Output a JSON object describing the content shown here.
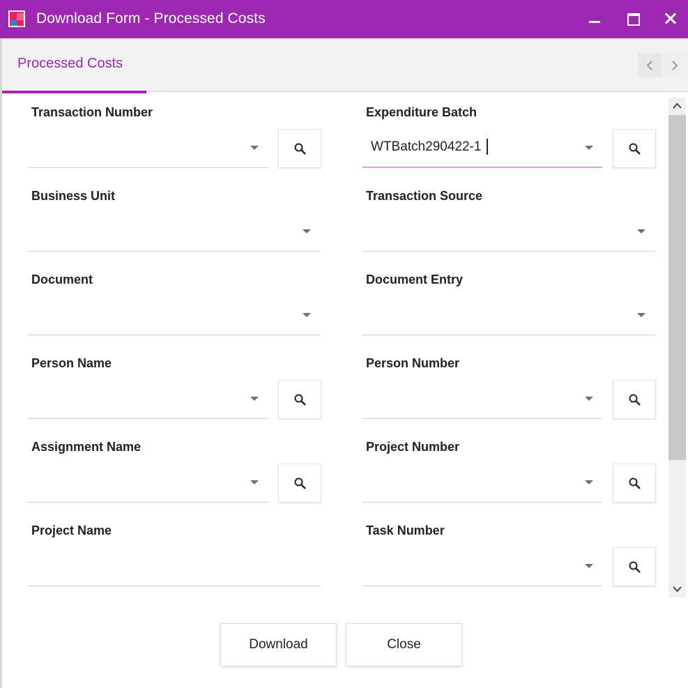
{
  "window": {
    "title": "Download Form - Processed Costs",
    "icon": "app-icon",
    "controls": [
      "minimize-icon",
      "maximize-icon",
      "close-icon"
    ]
  },
  "tabs": {
    "active": "Processed Costs",
    "nav": [
      "chevron-left-icon",
      "chevron-right-icon"
    ]
  },
  "fields": {
    "transaction_number": {
      "label": "Transaction Number",
      "value": ""
    },
    "expenditure_batch": {
      "label": "Expenditure Batch",
      "value": "WTBatch290422-1"
    },
    "business_unit": {
      "label": "Business Unit",
      "value": ""
    },
    "transaction_source": {
      "label": "Transaction Source",
      "value": ""
    },
    "document": {
      "label": "Document",
      "value": ""
    },
    "document_entry": {
      "label": "Document Entry",
      "value": ""
    },
    "person_name": {
      "label": "Person Name",
      "value": ""
    },
    "person_number": {
      "label": "Person Number",
      "value": ""
    },
    "assignment_name": {
      "label": "Assignment Name",
      "value": ""
    },
    "project_number": {
      "label": "Project Number",
      "value": ""
    },
    "project_name": {
      "label": "Project Name",
      "value": ""
    },
    "task_number": {
      "label": "Task Number",
      "value": ""
    }
  },
  "buttons": {
    "download": "Download",
    "close": "Close"
  },
  "colors": {
    "accent": "#9c27b0",
    "active_underline": "#d7a4e0"
  }
}
